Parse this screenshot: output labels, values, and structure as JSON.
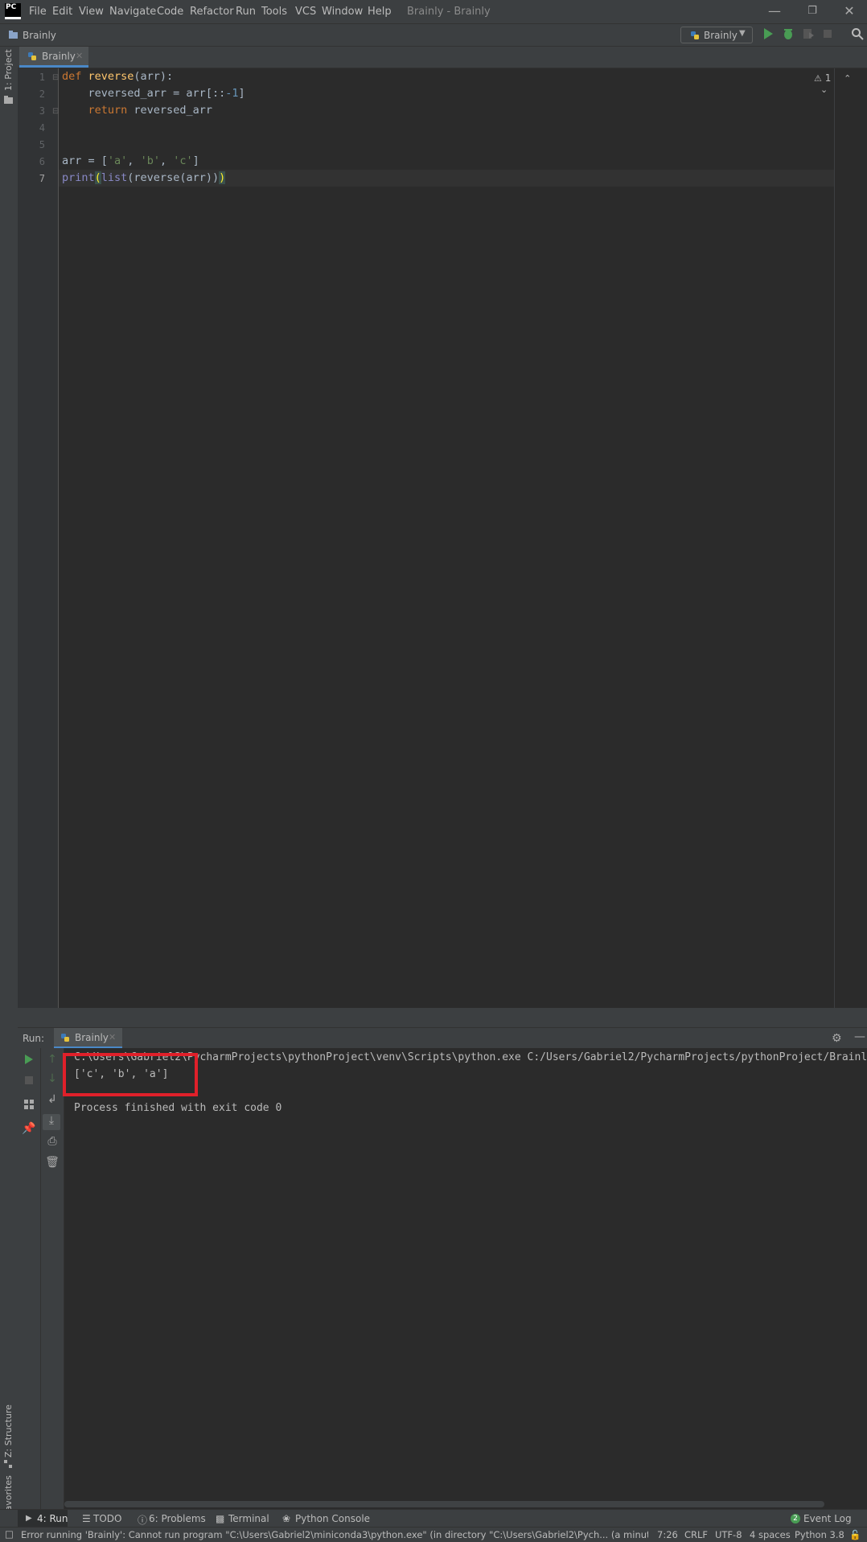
{
  "menu": {
    "logo": "PC",
    "items": [
      "File",
      "Edit",
      "View",
      "Navigate",
      "Code",
      "Refactor",
      "Run",
      "Tools",
      "VCS",
      "Window",
      "Help"
    ],
    "window_title": "Brainly - Brainly"
  },
  "nav": {
    "breadcrumb": "Brainly",
    "run_config": "Brainly"
  },
  "left_strip": {
    "project": "1: Project",
    "structure": "Z: Structure",
    "favorites": "2: Favorites"
  },
  "editor": {
    "tab_label": "Brainly",
    "line_numbers": [
      "1",
      "2",
      "3",
      "4",
      "5",
      "6",
      "7"
    ],
    "inspection_count": "1",
    "code": {
      "l1_kw": "def ",
      "l1_fn": "reverse",
      "l1_rest": "(arr):",
      "l2_indent": "    ",
      "l2_a": "reversed_arr = arr[::",
      "l2_num": "-1",
      "l2_b": "]",
      "l3_indent": "    ",
      "l3_kw": "return ",
      "l3_rest": "reversed_arr",
      "l6_a": "arr = [",
      "l6_s1": "'a'",
      "l6_c1": ", ",
      "l6_s2": "'b'",
      "l6_c2": ", ",
      "l6_s3": "'c'",
      "l6_b": "]",
      "l7_print": "print",
      "l7_p1": "(",
      "l7_list": "list",
      "l7_rest": "(reverse(arr))",
      "l7_p2": ")"
    }
  },
  "run": {
    "label": "Run:",
    "tab_label": "Brainly",
    "console": {
      "command": "C:\\Users\\Gabriel2\\PycharmProjects\\pythonProject\\venv\\Scripts\\python.exe C:/Users/Gabriel2/PycharmProjects/pythonProject/Brainly.py",
      "output": "['c', 'b', 'a']",
      "exit": "Process finished with exit code 0"
    }
  },
  "bottom_tools": {
    "run": "4: Run",
    "todo": "TODO",
    "problems": "6: Problems",
    "terminal": "Terminal",
    "python_console": "Python Console",
    "event_log": "Event Log",
    "event_count": "2"
  },
  "status": {
    "message": "Error running 'Brainly': Cannot run program \"C:\\Users\\Gabriel2\\miniconda3\\python.exe\" (in directory \"C:\\Users\\Gabriel2\\Pych... (a minute ago)",
    "position": "7:26",
    "line_sep": "CRLF",
    "encoding": "UTF-8",
    "indent": "4 spaces",
    "interpreter": "Python 3.8"
  },
  "colors": {
    "accent": "#4a88c7",
    "highlight": "#e0202a",
    "run_green": "#499c54"
  }
}
